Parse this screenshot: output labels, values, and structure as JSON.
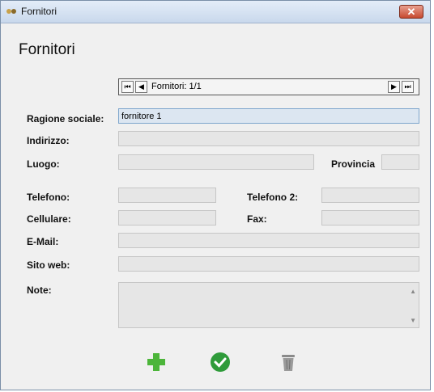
{
  "window": {
    "title": "Fornitori",
    "close_glyph": "✕"
  },
  "heading": "Fornitori",
  "navigator": {
    "text": "Fornitori: 1/1",
    "first_glyph": "⏮",
    "prev_glyph": "◀",
    "next_glyph": "▶",
    "last_glyph": "⏭"
  },
  "fields": {
    "ragione_sociale": {
      "label": "Ragione sociale:",
      "value": "fornitore 1"
    },
    "indirizzo": {
      "label": "Indirizzo:",
      "value": ""
    },
    "luogo": {
      "label": "Luogo:",
      "value": ""
    },
    "provincia": {
      "label": "Provincia",
      "value": ""
    },
    "telefono": {
      "label": "Telefono:",
      "value": ""
    },
    "telefono2": {
      "label": "Telefono 2:",
      "value": ""
    },
    "cellulare": {
      "label": "Cellulare:",
      "value": ""
    },
    "fax": {
      "label": "Fax:",
      "value": ""
    },
    "email": {
      "label": "E-Mail:",
      "value": ""
    },
    "sito_web": {
      "label": "Sito web:",
      "value": ""
    },
    "note": {
      "label": "Note:",
      "value": ""
    }
  },
  "actions": {
    "add_icon": "plus-icon",
    "save_icon": "check-icon",
    "delete_icon": "trash-icon"
  },
  "colors": {
    "add": "#4cb53a",
    "save": "#2f9b3a",
    "delete": "#8a8a8a",
    "close": "#c74a30"
  }
}
